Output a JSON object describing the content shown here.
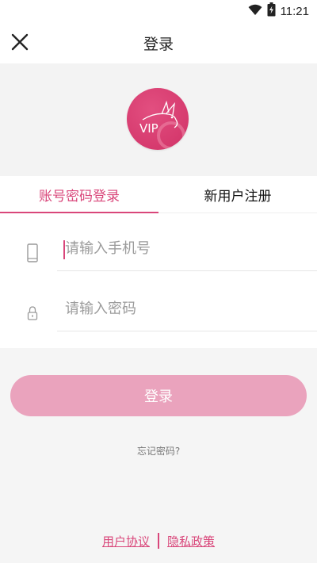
{
  "status_bar": {
    "time": "11:21",
    "icons": [
      "wifi-icon",
      "battery-icon"
    ]
  },
  "nav": {
    "title": "登录",
    "close_icon": "close-icon"
  },
  "logo": {
    "text": "VIP"
  },
  "tabs": [
    {
      "label": "账号密码登录",
      "active": true
    },
    {
      "label": "新用户注册",
      "active": false
    }
  ],
  "form": {
    "phone": {
      "value": "",
      "placeholder": "请输入手机号",
      "icon": "phone-icon"
    },
    "password": {
      "value": "",
      "placeholder": "请输入密码",
      "icon": "lock-icon"
    }
  },
  "login_button": {
    "label": "登录"
  },
  "forgot_password": {
    "label": "忘记密码?"
  },
  "footer": {
    "user_agreement": "用户协议",
    "privacy_policy": "隐私政策"
  },
  "colors": {
    "accent": "#d9467a",
    "button_bg": "#eaa3bd",
    "logo_bg": "#d63a6e"
  }
}
